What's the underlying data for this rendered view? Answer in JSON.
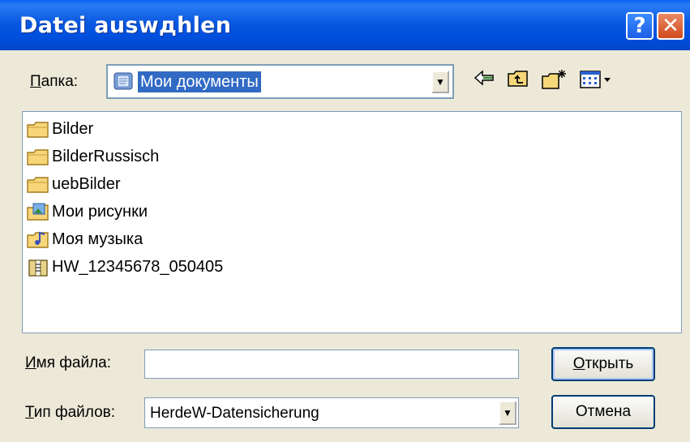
{
  "window": {
    "title": "Datei auswдhlen"
  },
  "title_buttons": {
    "help": "?",
    "close": "✕"
  },
  "folder": {
    "label_u": "П",
    "label_rest": "апка:",
    "current": "Мои документы"
  },
  "files": [
    {
      "name": "Bilder",
      "icon": "folder-icon"
    },
    {
      "name": "BilderRussisch",
      "icon": "folder-icon"
    },
    {
      "name": "uebBilder",
      "icon": "folder-icon"
    },
    {
      "name": "Мои рисунки",
      "icon": "pictures-folder-icon"
    },
    {
      "name": "Моя музыка",
      "icon": "music-folder-icon"
    },
    {
      "name": "HW_12345678_050405",
      "icon": "archive-icon"
    }
  ],
  "filename": {
    "label_u": "И",
    "label_rest": "мя файла:",
    "value": ""
  },
  "filetype": {
    "label_u": "Т",
    "label_rest": "ип файлов:",
    "value": "HerdeW-Datensicherung"
  },
  "buttons": {
    "open_u": "О",
    "open_rest": "ткрыть",
    "cancel": "Отмена"
  },
  "colors": {
    "title_blue": "#0050e0",
    "selection": "#316ac5",
    "dialog_bg": "#ece9d8"
  }
}
